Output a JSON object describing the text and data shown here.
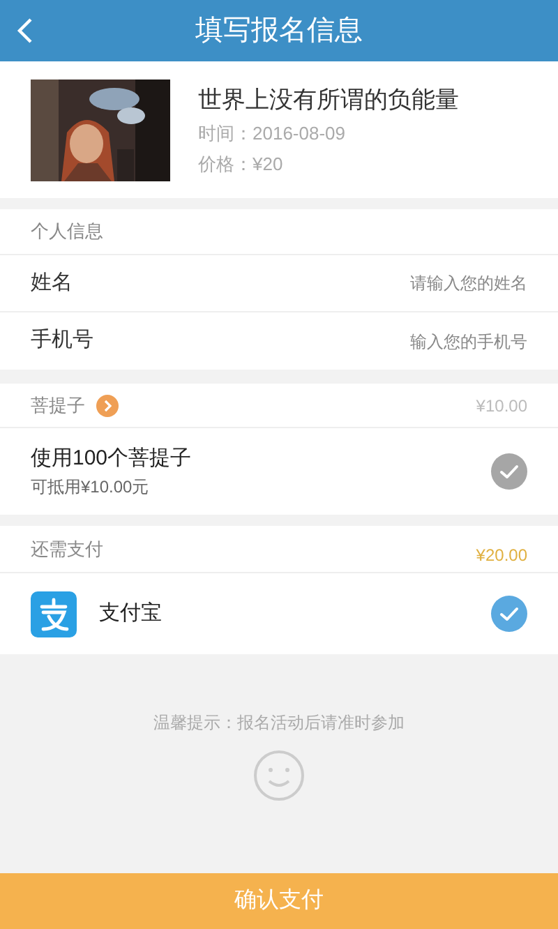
{
  "header": {
    "title": "填写报名信息"
  },
  "event": {
    "title": "世界上没有所谓的负能量",
    "time": "时间：2016-08-09",
    "price": "价格：¥20"
  },
  "personal": {
    "heading": "个人信息",
    "fields": [
      {
        "label": "姓名",
        "placeholder": "请输入您的姓名"
      },
      {
        "label": "手机号",
        "placeholder": "输入您的手机号"
      }
    ]
  },
  "bodhi": {
    "heading": "菩提子",
    "amount": "¥10.00",
    "option": {
      "title": "使用100个菩提子",
      "subtitle": "可抵用¥10.00元",
      "checked": false
    }
  },
  "payment": {
    "heading": "还需支付",
    "amount": "¥20.00",
    "methods": [
      {
        "name": "支付宝",
        "checked": true
      }
    ]
  },
  "tip": "温馨提示：报名活动后请准时参加",
  "confirm_button": "确认支付"
}
